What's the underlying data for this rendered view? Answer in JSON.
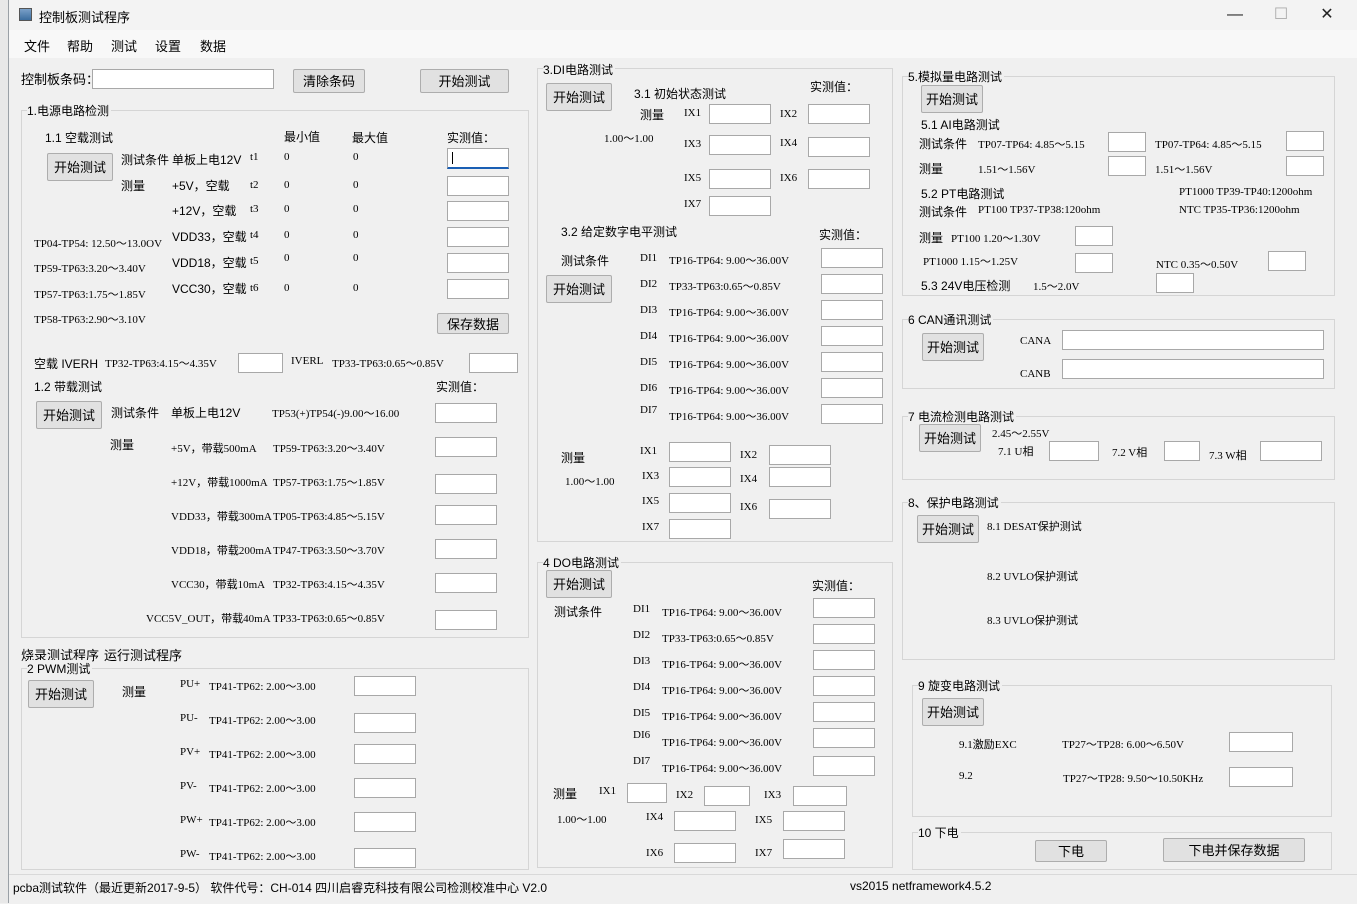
{
  "window": {
    "title": "控制板测试程序",
    "controls": {
      "minimize": "—",
      "maximize": "☐",
      "close": "✕"
    }
  },
  "menu": [
    "文件",
    "帮助",
    "测试",
    "设置",
    "数据"
  ],
  "barcode": {
    "label": "控制板条码：",
    "value": "",
    "clear_btn": "清除条码",
    "start_btn": "开始测试"
  },
  "power": {
    "title": "1.电源电路检测",
    "noload": {
      "title": "1.1  空载测试",
      "start_btn": "开始测试",
      "cond_label": "测试条件",
      "cond_value": "单板上电12V",
      "measure_label": "测量",
      "min_hdr": "最小值",
      "max_hdr": "最大值",
      "actual_hdr": "实测值：",
      "rows": [
        {
          "name": "t1",
          "min": "0",
          "max": "0"
        },
        {
          "name": "t2",
          "label": "+5V，空载",
          "min": "0",
          "max": "0"
        },
        {
          "name": "t3",
          "label": "+12V，空载",
          "min": "0",
          "max": "0"
        },
        {
          "name": "t4",
          "label": "VDD33，空载",
          "min": "0",
          "max": "0"
        },
        {
          "name": "t5",
          "label": "VDD18，空载",
          "min": "0",
          "max": "0"
        },
        {
          "name": "t6",
          "label": "VCC30，空载",
          "min": "0",
          "max": "0"
        }
      ],
      "refs": [
        "TP04-TP54: 12.50～13.0OV",
        "TP59-TP63:3.20～3.40V",
        "TP57-TP63:1.75～1.85V",
        "TP58-TP63:2.90～3.10V"
      ],
      "save_btn": "保存数据"
    },
    "noload_extra": {
      "label1": "空载 IVERH",
      "ref1": "TP32-TP63:4.15～4.35V",
      "label2": "IVERL",
      "ref2": "TP33-TP63:0.65～0.85V"
    },
    "load": {
      "title": "1.2  带载测试",
      "start_btn": "开始测试",
      "cond_label": "测试条件",
      "cond_value": "单板上电12V",
      "cond_ref": "TP53(+)TP54(-)9.00～16.00",
      "measure_label": "测量",
      "actual_hdr": "实测值：",
      "rows": [
        {
          "label": "+5V，带载500mA",
          "ref": "TP59-TP63:3.20～3.40V"
        },
        {
          "label": "+12V，带载1000mA",
          "ref": "TP57-TP63:1.75～1.85V"
        },
        {
          "label": "VDD33，带载300mA",
          "ref": "TP05-TP63:4.85～5.15V"
        },
        {
          "label": "VDD18，带载200mA",
          "ref": "TP47-TP63:3.50～3.70V"
        },
        {
          "label": "VCC30，带载10mA",
          "ref": "TP32-TP63:4.15～4.35V"
        },
        {
          "label": "VCC5V_OUT，带载40mA",
          "ref": "TP33-TP63:0.65～0.85V"
        }
      ]
    }
  },
  "tabs": [
    "烧录测试程序",
    "运行测试程序"
  ],
  "pwm": {
    "title": "2 PWM测试",
    "start_btn": "开始测试",
    "measure_label": "测量",
    "rows": [
      {
        "label": "PU+",
        "ref": "TP41-TP62: 2.00～3.00"
      },
      {
        "label": "PU-",
        "ref": "TP41-TP62: 2.00～3.00"
      },
      {
        "label": "PV+",
        "ref": "TP41-TP62: 2.00～3.00"
      },
      {
        "label": "PV-",
        "ref": "TP41-TP62: 2.00～3.00"
      },
      {
        "label": "PW+",
        "ref": "TP41-TP62: 2.00～3.00"
      },
      {
        "label": "PW-",
        "ref": "TP41-TP62: 2.00～3.00"
      }
    ]
  },
  "di": {
    "title": "3.DI电路测试",
    "start_btn": "开始测试",
    "init": {
      "title": "3.1  初始状态测试",
      "actual_hdr": "实测值：",
      "measure_label": "测量",
      "range": "1.00～1.00",
      "ix": [
        "IX1",
        "IX2",
        "IX3",
        "IX4",
        "IX5",
        "IX6",
        "IX7"
      ]
    },
    "given": {
      "title": "3.2 给定数字电平测试",
      "actual_hdr": "实测值：",
      "cond_label": "测试条件",
      "start_btn": "开始测试",
      "rows": [
        {
          "label": "DI1",
          "ref": "TP16-TP64: 9.00～36.00V"
        },
        {
          "label": "DI2",
          "ref": "TP33-TP63:0.65～0.85V"
        },
        {
          "label": "DI3",
          "ref": "TP16-TP64: 9.00～36.00V"
        },
        {
          "label": "DI4",
          "ref": "TP16-TP64: 9.00～36.00V"
        },
        {
          "label": "DI5",
          "ref": "TP16-TP64: 9.00～36.00V"
        },
        {
          "label": "DI6",
          "ref": "TP16-TP64: 9.00～36.00V"
        },
        {
          "label": "DI7",
          "ref": "TP16-TP64: 9.00～36.00V"
        }
      ],
      "measure_label": "测量",
      "range": "1.00～1.00",
      "ix": [
        "IX1",
        "IX2",
        "IX3",
        "IX4",
        "IX5",
        "IX6",
        "IX7"
      ]
    }
  },
  "do": {
    "title": "4 DO电路测试",
    "start_btn": "开始测试",
    "actual_hdr": "实测值：",
    "cond_label": "测试条件",
    "rows": [
      {
        "label": "DI1",
        "ref": "TP16-TP64: 9.00～36.00V"
      },
      {
        "label": "DI2",
        "ref": "TP33-TP63:0.65～0.85V"
      },
      {
        "label": "DI3",
        "ref": "TP16-TP64: 9.00～36.00V"
      },
      {
        "label": "DI4",
        "ref": "TP16-TP64: 9.00～36.00V"
      },
      {
        "label": "DI5",
        "ref": "TP16-TP64: 9.00～36.00V"
      },
      {
        "label": "DI6",
        "ref": "TP16-TP64: 9.00～36.00V"
      },
      {
        "label": "DI7",
        "ref": "TP16-TP64: 9.00～36.00V"
      }
    ],
    "measure_label": "测量",
    "range": "1.00～1.00",
    "ix": [
      "IX1",
      "IX2",
      "IX3",
      "IX4",
      "IX5",
      "IX6",
      "IX7"
    ]
  },
  "analog": {
    "title": "5.模拟量电路测试",
    "start_btn": "开始测试",
    "ai": {
      "title": "5.1 AI电路测试",
      "cond_label": "测试条件",
      "cond1": "TP07-TP64: 4.85～5.15",
      "cond2": "TP07-TP64: 4.85～5.15",
      "measure_label": "测量",
      "meas1": "1.51～1.56V",
      "meas2": "1.51～1.56V"
    },
    "pt": {
      "title": "5.2 PT电路测试",
      "ref_pt1000": "PT1000 TP39-TP40:1200ohm",
      "cond_label": "测试条件",
      "cond_pt100": "PT100 TP37-TP38:120ohm",
      "ref_ntc": "NTC TP35-TP36:1200ohm",
      "measure_label": "测量",
      "pt100": "PT100 1.20～1.30V",
      "pt1000": "PT1000 1.15～1.25V",
      "ntc": "NTC  0.35～0.50V"
    },
    "v24": {
      "label": "5.3 24V电压检测",
      "range": "1.5～2.0V"
    }
  },
  "can": {
    "title": "6 CAN通讯测试",
    "start_btn": "开始测试",
    "cana": "CANA",
    "canb": "CANB"
  },
  "current": {
    "title": "7 电流检测电路测试",
    "start_btn": "开始测试",
    "range": "2.45～2.55V",
    "u": "7.1 U相",
    "v": "7.2 V相",
    "w": "7.3 W相"
  },
  "protect": {
    "title": "8、保护电路测试",
    "start_btn": "开始测试",
    "items": [
      "8.1 DESAT保护测试",
      "8.2 UVLO保护测试",
      "8.3 UVLO保护测试"
    ]
  },
  "resolver": {
    "title": "9 旋变电路测试",
    "start_btn": "开始测试",
    "exc_label": "9.1激励EXC",
    "exc_ref": "TP27～TP28: 6.00～6.50V",
    "f_label": "9.2",
    "f_ref": "TP27～TP28: 9.50～10.50KHz"
  },
  "poweroff": {
    "title": "10 下电",
    "btn1": "下电",
    "btn2": "下电并保存数据"
  },
  "status": {
    "left": "pcba测试软件（最近更新2017-9-5）  软件代号：CH-014  四川启睿克科技有限公司检测校准中心  V2.0",
    "right": "vs2015 netframework4.5.2"
  }
}
